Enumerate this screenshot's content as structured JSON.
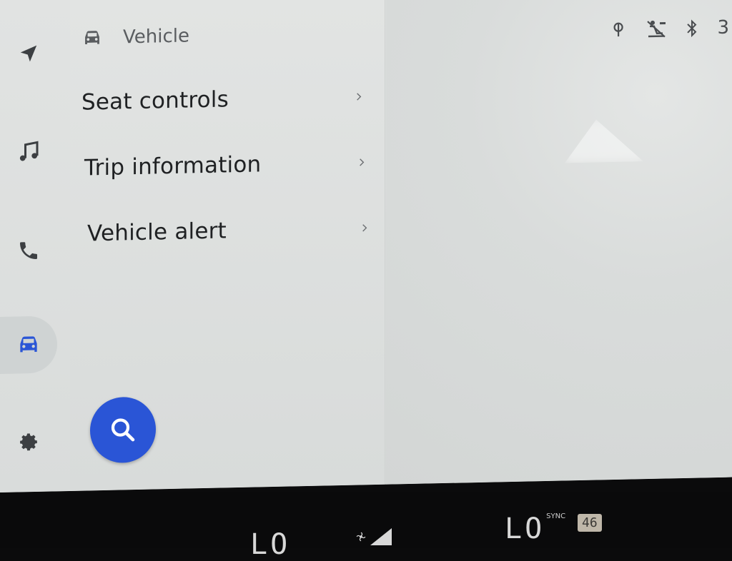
{
  "panel": {
    "title": "Vehicle",
    "items": [
      {
        "label": "Seat controls"
      },
      {
        "label": "Trip information"
      },
      {
        "label": "Vehicle alert"
      }
    ]
  },
  "rail": {
    "icons": [
      "navigation-icon",
      "music-icon",
      "phone-icon",
      "car-icon",
      "settings-icon"
    ],
    "active": "car-icon"
  },
  "status_bar": {
    "icons": [
      "wireless-charging-icon",
      "seatbelt-alert-icon",
      "bluetooth-icon"
    ],
    "text": "3"
  },
  "climate": {
    "left_temp": "LO",
    "right_temp": "LO",
    "sync_label": "SYNC",
    "badge": "46"
  },
  "colors": {
    "accent": "#2a55d6",
    "text_primary": "#1f2123",
    "text_secondary": "#5a5d60"
  }
}
